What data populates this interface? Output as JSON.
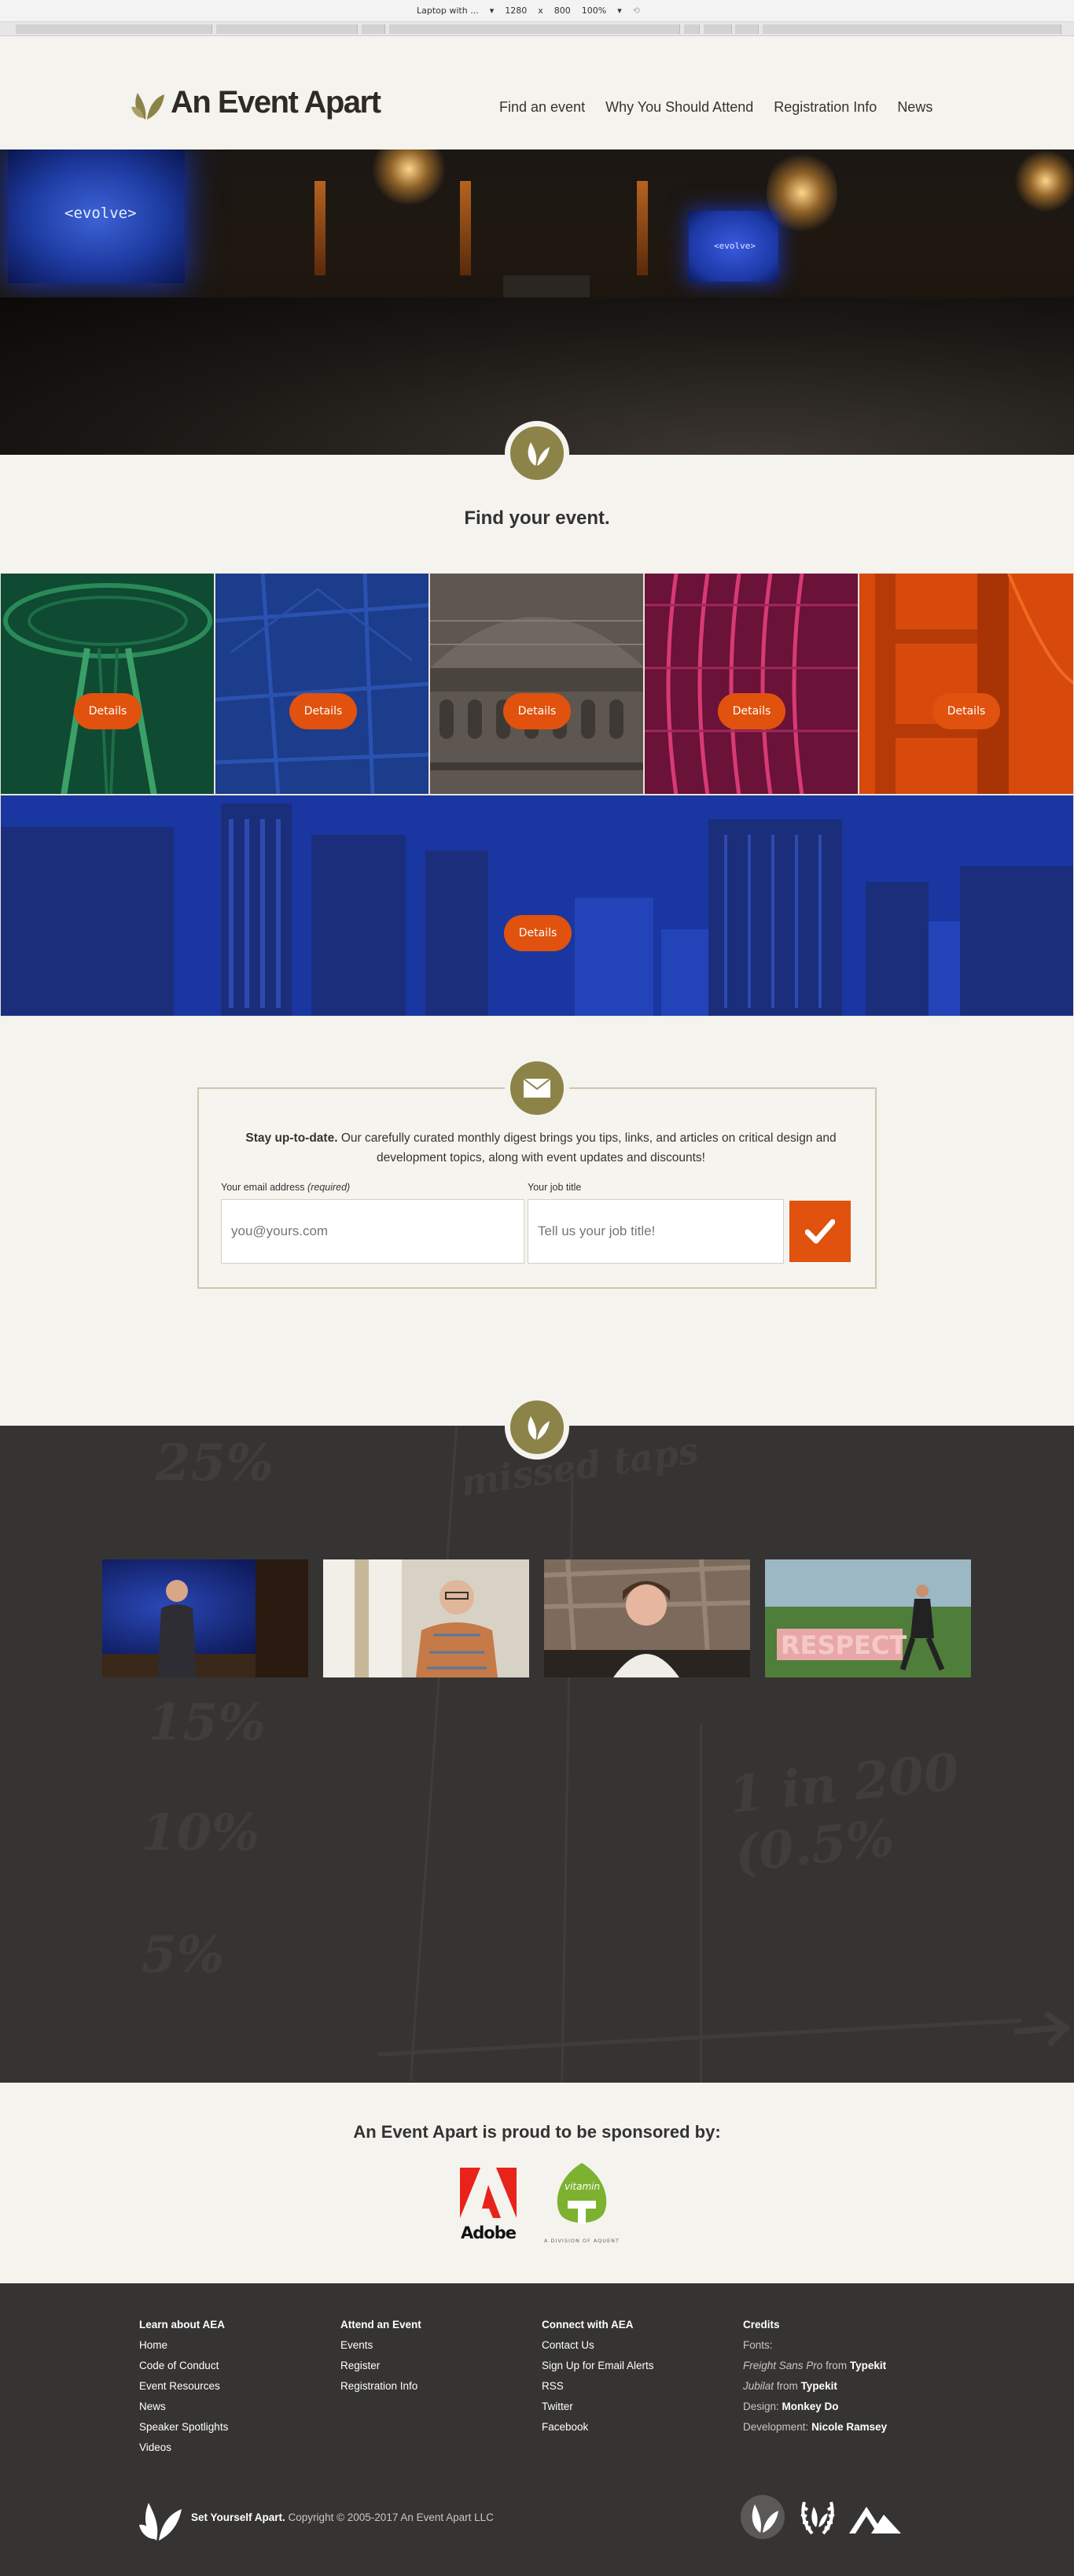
{
  "devtools": {
    "device": "Laptop with ...",
    "width": "1280",
    "times": "x",
    "height": "800",
    "zoom": "100%"
  },
  "site": {
    "logo_text": "An Event Apart",
    "nav": [
      "Find an event",
      "Why You Should Attend",
      "Registration Info",
      "News"
    ]
  },
  "hero": {
    "screen_left": "<evolve>",
    "screen_right": "<evolve>"
  },
  "events": {
    "title": "Find your event.",
    "details_label": "Details"
  },
  "newsletter": {
    "lead": "Stay up-to-date.",
    "body": " Our carefully curated monthly digest brings you tips, links, and articles on critical design and development topics, along with event updates and discounts!",
    "email_label": "Your email address",
    "email_required": "(required)",
    "email_placeholder": "you@yours.com",
    "job_label": "Your job title",
    "job_placeholder": "Tell us your job title!"
  },
  "stats_bg": {
    "pct25": "25%",
    "pct15": "15%",
    "pct10": "10%",
    "pct5": "5%",
    "missed": "missed taps",
    "ratio": "1 in 200 (0.5%"
  },
  "sponsors": {
    "title": "An Event Apart is proud to be sponsored by:",
    "adobe": "Adobe",
    "vitamint": "vitamin",
    "aquent": "A DIVISION OF AQUENT"
  },
  "footer": {
    "col1": {
      "title": "Learn about AEA",
      "links": [
        "Home",
        "Code of Conduct",
        "Event Resources",
        "News",
        "Speaker Spotlights",
        "Videos"
      ]
    },
    "col2": {
      "title": "Attend an Event",
      "links": [
        "Events",
        "Register",
        "Registration Info"
      ]
    },
    "col3": {
      "title": "Connect with AEA",
      "links": [
        "Contact Us",
        "Sign Up for Email Alerts",
        "RSS",
        "Twitter",
        "Facebook"
      ]
    },
    "col4": {
      "title": "Credits",
      "fonts_label": "Fonts:",
      "font1": "Freight Sans Pro",
      "font2": "Jubilat",
      "from": "from",
      "typekit": "Typekit",
      "design_label": "Design:",
      "design": "Monkey Do",
      "dev_label": "Development:",
      "dev": "Nicole Ramsey"
    },
    "tagline": "Set Yourself Apart.",
    "copyright": "Copyright © 2005-2017 An Event Apart LLC"
  }
}
